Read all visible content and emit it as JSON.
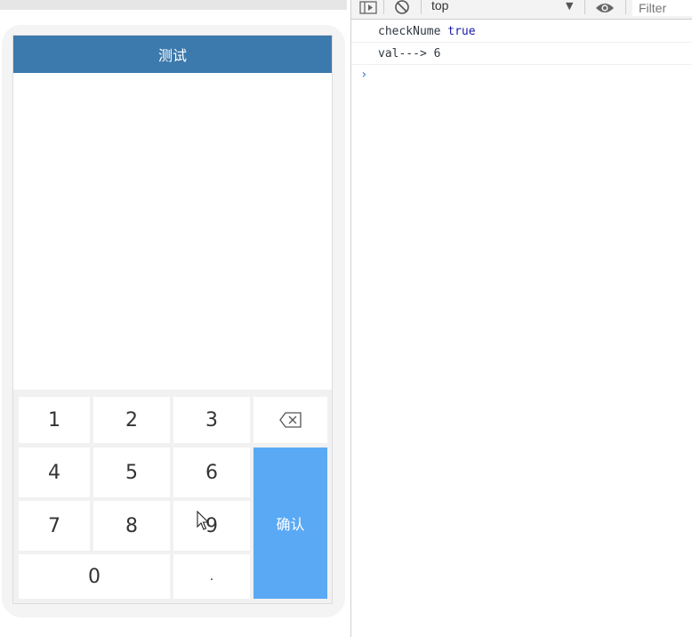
{
  "app": {
    "title": "测试",
    "keypad": {
      "row1": [
        "1",
        "2",
        "3"
      ],
      "row2": [
        "4",
        "5",
        "6"
      ],
      "row3": [
        "7",
        "8",
        "9"
      ],
      "zero": "0",
      "dot": ".",
      "backspace_icon": "backspace-icon",
      "confirm_label": "确认"
    },
    "colors": {
      "header": "#3c79ad",
      "confirm": "#5aa9f5"
    }
  },
  "devtools": {
    "context_value": "top",
    "filter_placeholder": "Filter",
    "toolbar_icons": [
      "sidebar-toggle-icon",
      "clear-console-icon",
      "dropdown-arrow-icon",
      "eye-icon"
    ],
    "logs": [
      {
        "label": "checkNume",
        "value": "true"
      },
      {
        "label": "val--->",
        "value": "6"
      }
    ],
    "prompt": "›"
  }
}
